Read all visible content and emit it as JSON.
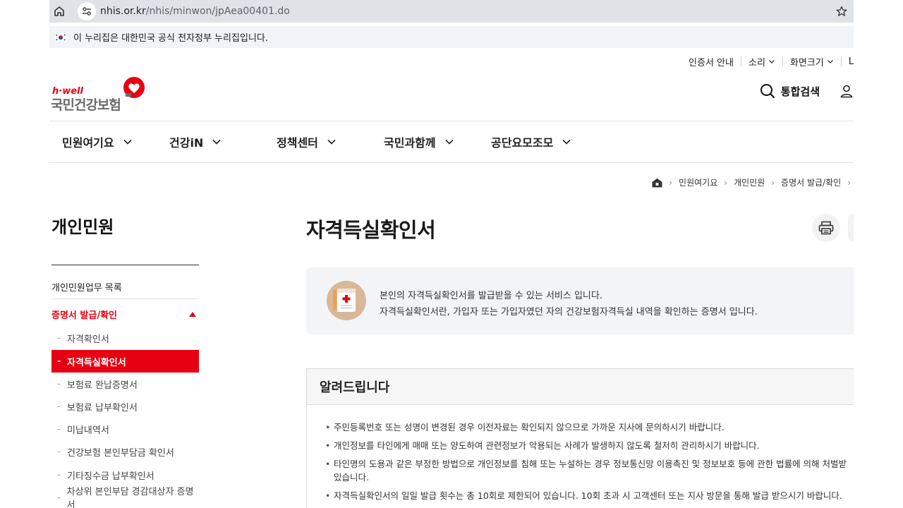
{
  "browser": {
    "url_host": "nhis.or.kr",
    "url_path": "/nhis/minwon/jpAea00401.do"
  },
  "gov_notice": "이 누리집은 대한민국 공식 전자정부 누리집입니다.",
  "utility": {
    "cert_guide": "인증서 안내",
    "sound": "소리",
    "font_size": "화면크기",
    "lang": "L"
  },
  "logo": {
    "brand": "h·well",
    "name": "국민건강보험"
  },
  "header": {
    "search_label": "통합검색"
  },
  "gnb": [
    "민원여기요",
    "건강iN",
    "정책센터",
    "국민과함께",
    "공단요모조모"
  ],
  "breadcrumb": [
    "민원여기요",
    "개인민원",
    "증명서 발급/확인"
  ],
  "lnb": {
    "title": "개인민원",
    "list_item": "개인민원업무 목록",
    "active_group": "증명서 발급/확인",
    "sub_items": [
      "자격확인서",
      "자격득실확인서",
      "보험료 완납증명서",
      "보험료 납부확인서",
      "미납내역서",
      "건강보험 본인부담금 확인서",
      "기타징수금 납부확인서",
      "차상위 본인부담 경감대상자 증명서"
    ],
    "active_index": 1
  },
  "main": {
    "title": "자격득실확인서",
    "intro_line1": "본인의 자격득실확인서를 발급받을 수 있는 서비스 입니다.",
    "intro_line2": "자격득실확인서란, 가입자 또는 가입자였던 자의 건강보험자격득실 내역을 확인하는 증명서 입니다.",
    "notice_title": "알려드립니다",
    "notices": [
      "주민등록번호 또는 성명이 변경된 경우 이전자료는 확인되지 않으므로 가까운 지사에 문의하시기 바랍니다.",
      "개인정보를 타인에게 매매 또는 양도하여 관련정보가 악용되는 사례가 발생하지 않도록 철저히 관리하시기 바랍니다.",
      "타인명의 도용과 같은 부정한 방법으로 개인정보를 침해 또는 누설하는 경우 정보통신망 이용촉진 및 정보보호 등에 관한 법률에 의해 처벌받",
      "있습니다.",
      "자격득실확인서의 일일 발급 횟수는 총 10회로 제한되어 있습니다. 10회 초과 시 고객센터 또는 지사 방문을 통해 발급 받으시기 바랍니다."
    ]
  },
  "colors": {
    "brand_red": "#e60012",
    "intro_bg": "#f3f4f6"
  }
}
